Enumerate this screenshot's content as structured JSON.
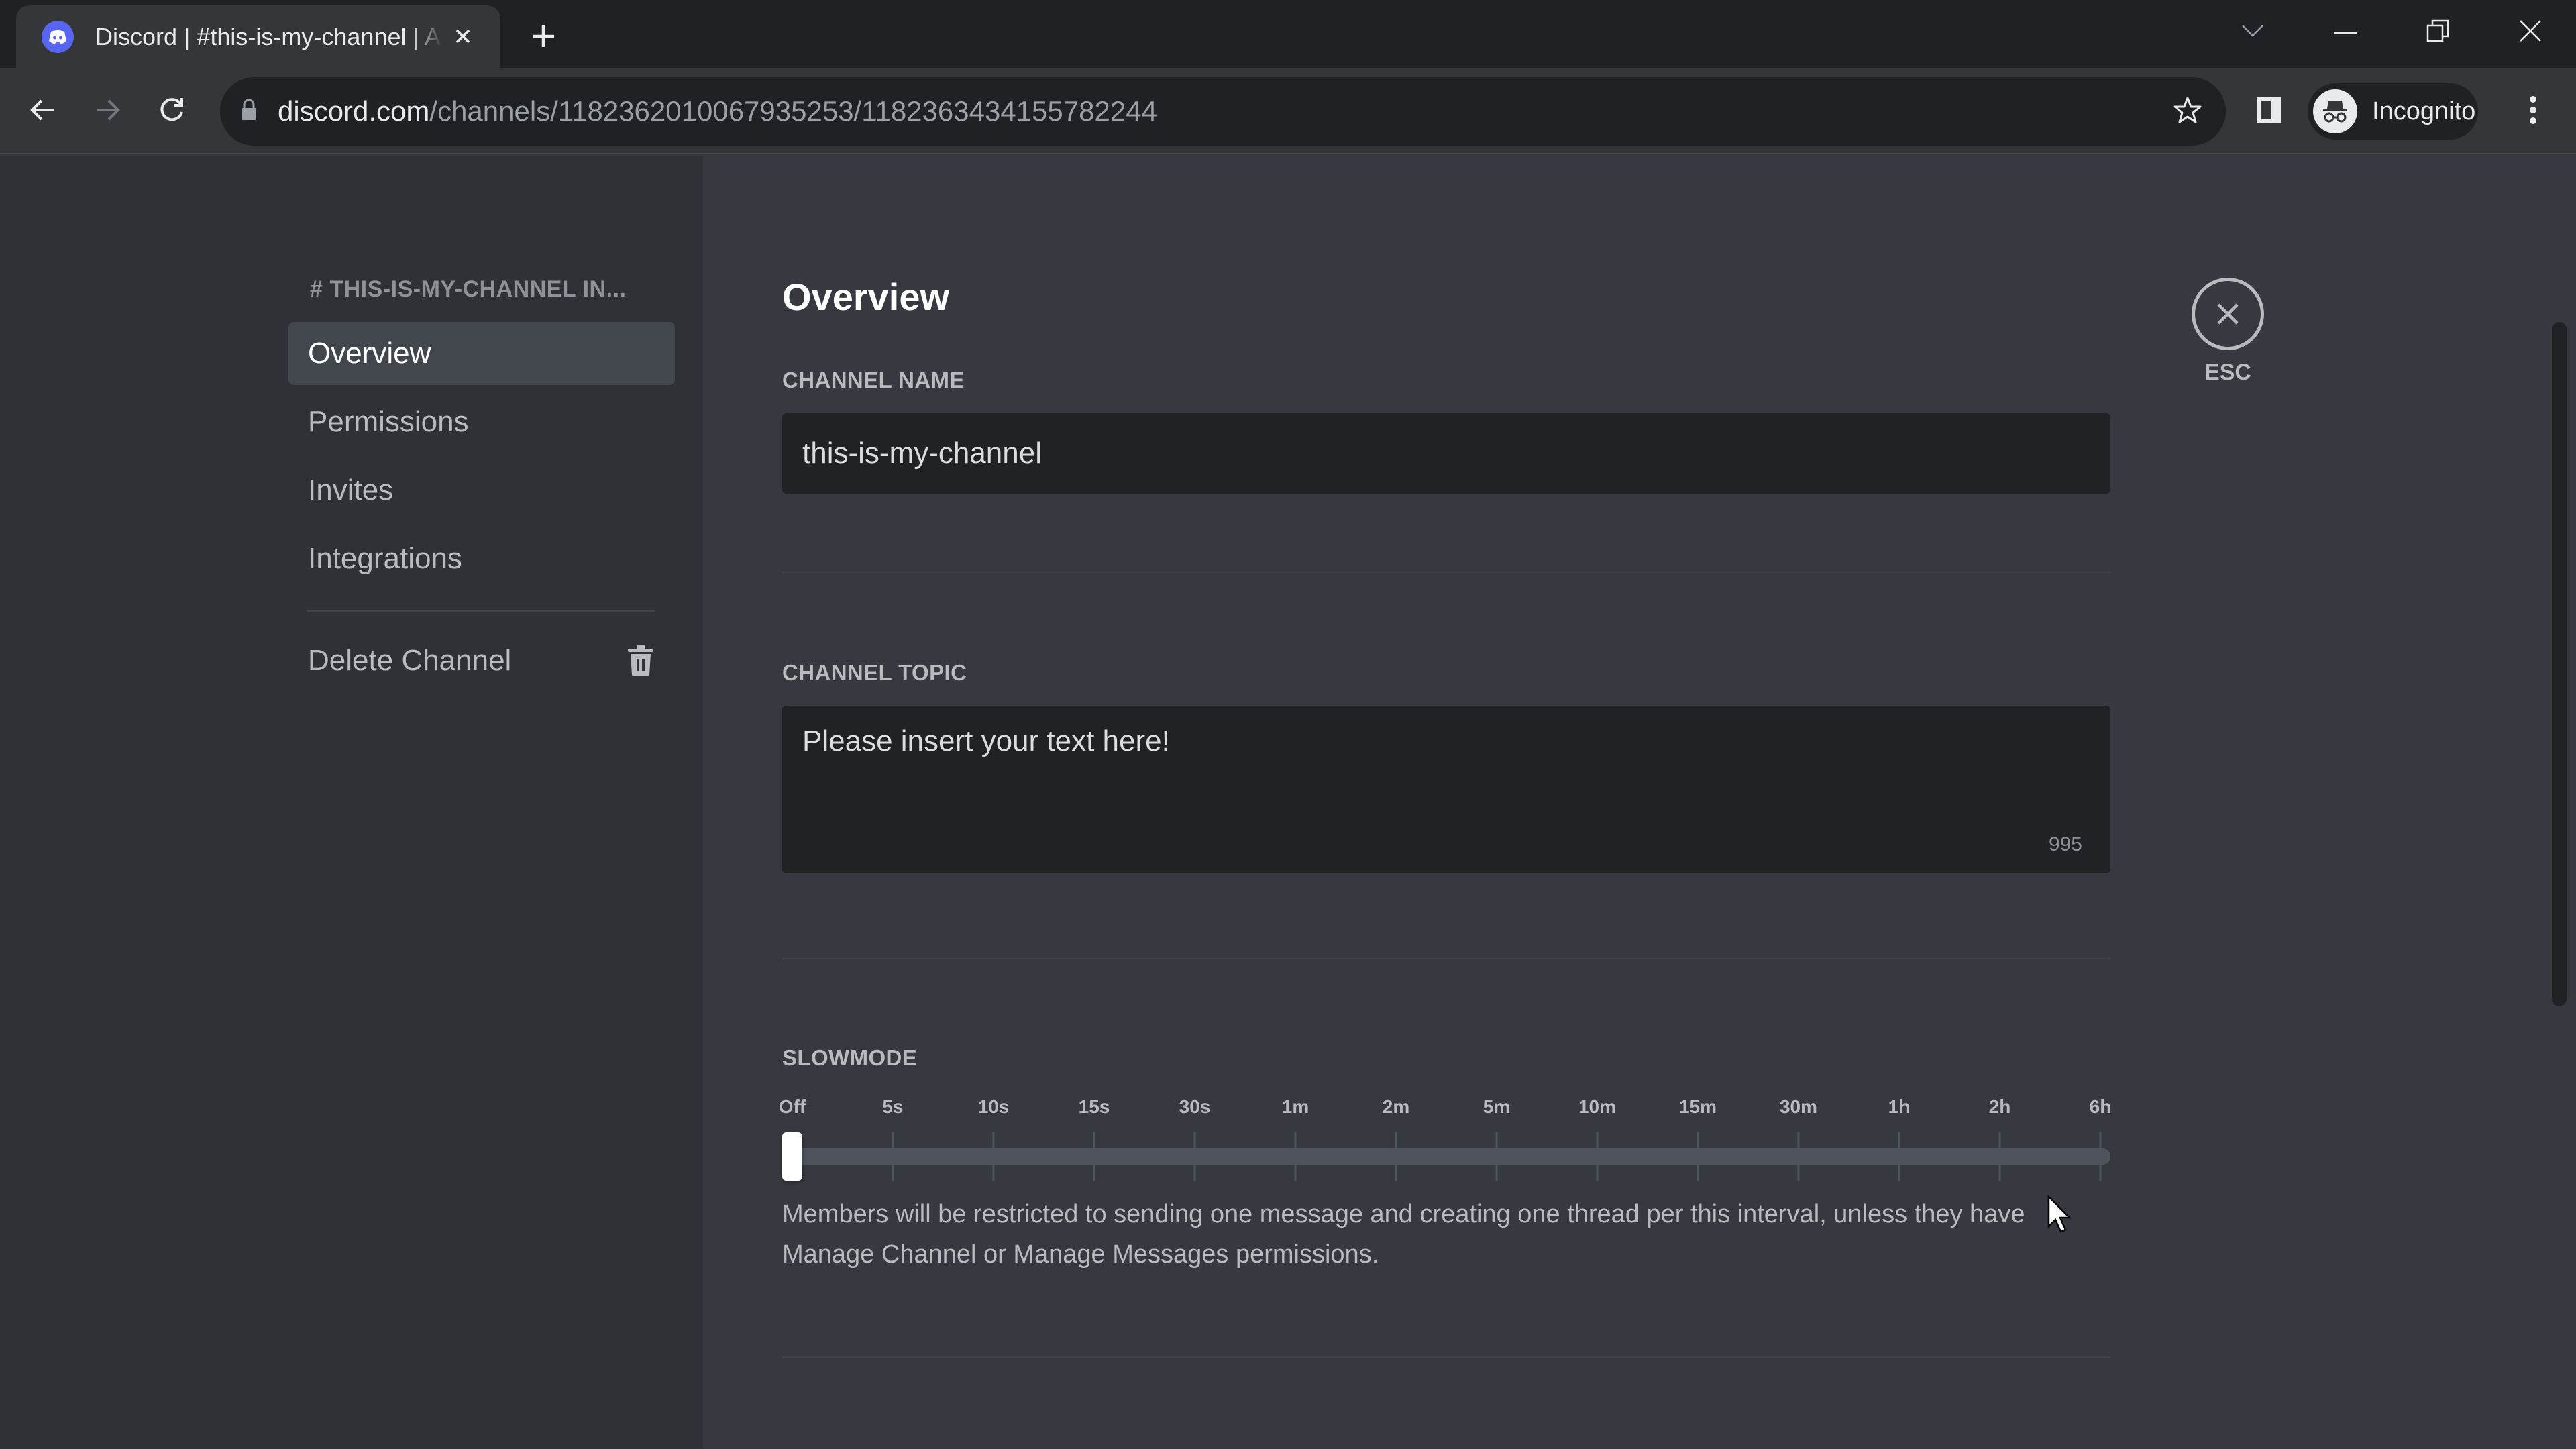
{
  "browser": {
    "tab_title": "Discord | #this-is-my-channel | A",
    "url_host": "discord.com",
    "url_path": "/channels/1182362010067935253/1182363434155782244",
    "profile_label": "Incognito",
    "icons": {
      "favicon": "discord-logo-icon",
      "tab_close": "close-icon",
      "new_tab": "plus-icon",
      "tab_search": "chevron-down-icon",
      "minimize": "minimize-icon",
      "restore": "restore-icon",
      "window_close": "close-icon",
      "back": "arrow-left-icon",
      "forward": "arrow-right-icon",
      "reload": "reload-icon",
      "lock": "lock-icon",
      "bookmark": "star-icon",
      "side_panel": "side-panel-icon",
      "incognito": "incognito-icon",
      "menu": "kebab-menu-icon"
    }
  },
  "sidebar": {
    "header": "# THIS-IS-MY-CHANNEL IN...",
    "items": [
      {
        "label": "Overview",
        "active": true
      },
      {
        "label": "Permissions",
        "active": false
      },
      {
        "label": "Invites",
        "active": false
      },
      {
        "label": "Integrations",
        "active": false
      }
    ],
    "delete_label": "Delete Channel",
    "delete_icon": "trash-icon"
  },
  "main": {
    "title": "Overview",
    "close_label": "ESC",
    "channel_name": {
      "label": "CHANNEL NAME",
      "value": "this-is-my-channel"
    },
    "channel_topic": {
      "label": "CHANNEL TOPIC",
      "value": "Please insert your text here!",
      "remaining_chars": "995"
    },
    "slowmode": {
      "label": "SLOWMODE",
      "options": [
        "Off",
        "5s",
        "10s",
        "15s",
        "30s",
        "1m",
        "2m",
        "5m",
        "10m",
        "15m",
        "30m",
        "1h",
        "2h",
        "6h"
      ],
      "selected_index": 0,
      "selected": "Off",
      "help_text": "Members will be restricted to sending one message and creating one thread per this interval, unless they have Manage Channel or Manage Messages permissions."
    }
  },
  "colors": {
    "brand": "#5865f2",
    "sidebar_bg": "#2f3136",
    "content_bg": "#36393f",
    "input_bg": "#202225",
    "active_item_bg": "#42464d"
  }
}
